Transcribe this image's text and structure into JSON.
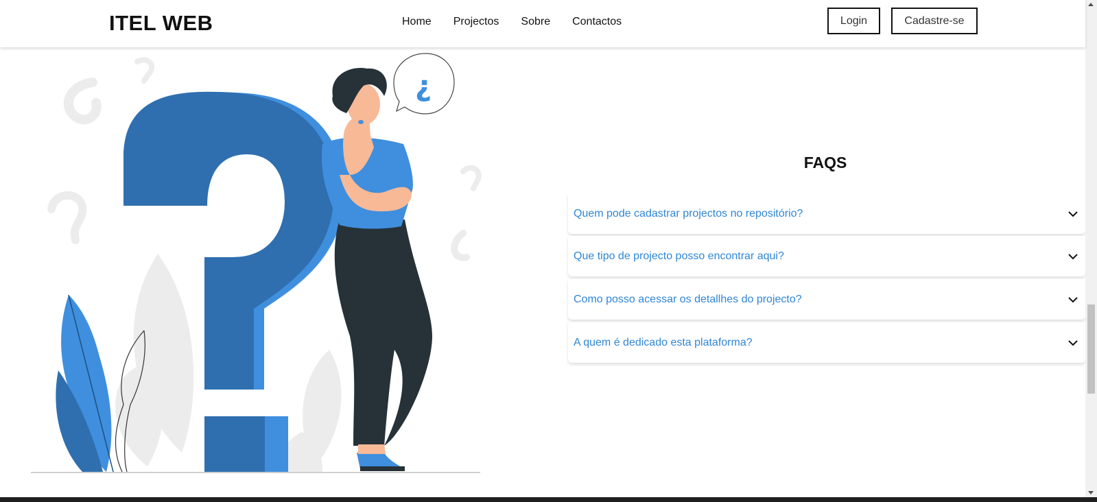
{
  "header": {
    "brand": "ITEL WEB",
    "nav": [
      "Home",
      "Projectos",
      "Sobre",
      "Contactos"
    ],
    "login_label": "Login",
    "signup_label": "Cadastre-se"
  },
  "illustration": {
    "bubble_glyph": "¿"
  },
  "faq": {
    "title": "FAQS",
    "items": [
      {
        "question": "Quem pode cadastrar projectos no repositório?"
      },
      {
        "question": "Que tipo de projecto posso encontrar aqui?"
      },
      {
        "question": "Como posso acessar os detallhes do projecto?"
      },
      {
        "question": "A quem é dedicado esta plataforma?"
      }
    ],
    "toggle_icon": "chevron-down-icon"
  },
  "colors": {
    "accent_blue": "#2f86d6",
    "question_dark": "#2f6faf",
    "question_light": "#3f8fde",
    "pants": "#263238"
  }
}
